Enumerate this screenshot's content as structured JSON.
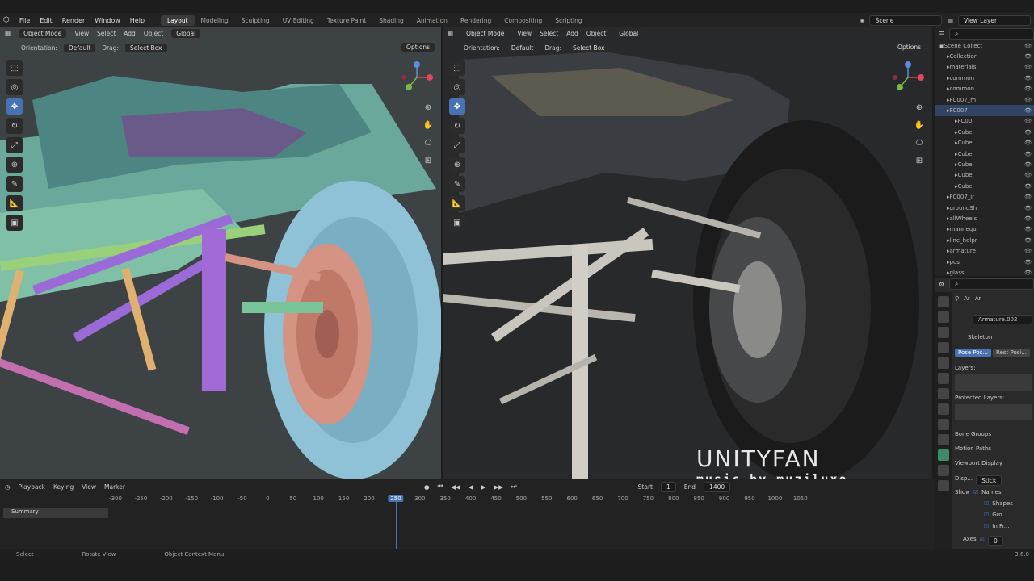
{
  "app": {
    "menus": [
      "File",
      "Edit",
      "Render",
      "Window",
      "Help"
    ],
    "workspaces": [
      "Layout",
      "Modeling",
      "Sculpting",
      "UV Editing",
      "Texture Paint",
      "Shading",
      "Animation",
      "Rendering",
      "Compositing",
      "Scripting"
    ],
    "scene": "Scene",
    "view_layer": "View Layer"
  },
  "viewport": {
    "mode": "Object Mode",
    "menu": [
      "View",
      "Select",
      "Add",
      "Object"
    ],
    "transform": "Global",
    "orientation_label": "Orientation:",
    "orientation_value": "Default",
    "drag_label": "Drag:",
    "drag_value": "Select Box",
    "options": "Options"
  },
  "outliner": {
    "rows": [
      {
        "name": "Scene Collect",
        "indent": 0
      },
      {
        "name": "Collectior",
        "indent": 1
      },
      {
        "name": "materials",
        "indent": 1
      },
      {
        "name": "common",
        "indent": 1
      },
      {
        "name": "common",
        "indent": 1
      },
      {
        "name": "FC007_m",
        "indent": 1
      },
      {
        "name": "FC007",
        "indent": 1
      },
      {
        "name": "FC00",
        "indent": 2
      },
      {
        "name": "Cube.",
        "indent": 2
      },
      {
        "name": "Cube.",
        "indent": 2
      },
      {
        "name": "Cube.",
        "indent": 2
      },
      {
        "name": "Cube.",
        "indent": 2
      },
      {
        "name": "Cube.",
        "indent": 2
      },
      {
        "name": "Cube.",
        "indent": 2
      },
      {
        "name": "FC007_ir",
        "indent": 1
      },
      {
        "name": "groundSh",
        "indent": 1
      },
      {
        "name": "allWheels",
        "indent": 1
      },
      {
        "name": "mannequ",
        "indent": 1
      },
      {
        "name": "line_helpr",
        "indent": 1
      },
      {
        "name": "armature",
        "indent": 1
      },
      {
        "name": "pos",
        "indent": 1
      },
      {
        "name": "glass",
        "indent": 1
      }
    ]
  },
  "properties": {
    "breadcrumb": "Ar",
    "armature_name": "Armature.002",
    "skeleton": "Skeleton",
    "pose_position": "Pose Pos...",
    "rest_position": "Rest Posi...",
    "layers": "Layers:",
    "protected_layers": "Protected Layers:",
    "bone_groups": "Bone Groups",
    "motion_paths": "Motion Paths",
    "viewport_display": "Viewport Display",
    "display_as_label": "Disp...",
    "display_as": "Stick",
    "show_label": "Show",
    "show_names": "Names",
    "show_shapes": "Shapes",
    "show_group": "Gro...",
    "show_front": "In Fr...",
    "axes": "Axes",
    "axes_value": "0"
  },
  "timeline": {
    "menus": [
      "Playback",
      "Keying",
      "View",
      "Marker"
    ],
    "summary": "Summary",
    "ticks": [
      "-300",
      "-250",
      "-200",
      "-150",
      "-100",
      "-50",
      "0",
      "50",
      "100",
      "150",
      "200",
      "250",
      "300",
      "350",
      "400",
      "450",
      "500",
      "550",
      "600",
      "650",
      "700",
      "750",
      "800",
      "850",
      "900",
      "950",
      "1000",
      "1050"
    ],
    "current_frame": "250",
    "start_label": "Start",
    "start": "1",
    "end_label": "End",
    "end": "1400"
  },
  "status": {
    "select": "Select",
    "rotate": "Rotate View",
    "context": "Object Context Menu",
    "version": "3.6.0"
  },
  "watermark": {
    "title": "UNITYFAN",
    "subtitle": "music by muziluxo"
  }
}
